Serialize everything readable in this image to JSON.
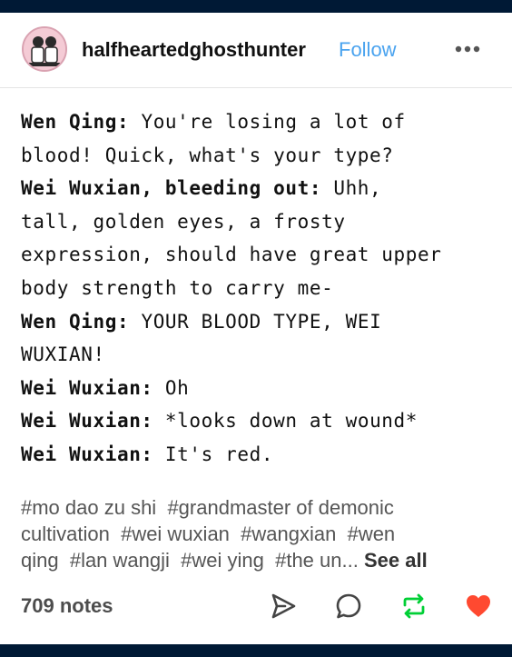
{
  "post": {
    "username": "halfheartedghosthunter",
    "follow_label": "Follow",
    "more_icon": "more-icon",
    "lines": [
      {
        "speaker": "Wen Qing:",
        "text": " You're losing a lot of"
      },
      {
        "speaker": "",
        "text": "blood! Quick, what's your type?"
      },
      {
        "speaker": "Wei Wuxian, bleeding out:",
        "text": " Uhh,"
      },
      {
        "speaker": "",
        "text": "tall, golden eyes, a frosty"
      },
      {
        "speaker": "",
        "text": "expression, should have great upper"
      },
      {
        "speaker": "",
        "text": "body strength to carry me-"
      },
      {
        "speaker": "Wen Qing:",
        "text": " YOUR BLOOD TYPE, WEI"
      },
      {
        "speaker": "",
        "text": "WUXIAN!"
      },
      {
        "speaker": "Wei Wuxian:",
        "text": " Oh"
      },
      {
        "speaker": "Wei Wuxian:",
        "text": " *looks down at wound*"
      },
      {
        "speaker": "Wei Wuxian:",
        "text": " It's red."
      }
    ],
    "tags": [
      "#mo dao zu shi",
      "#grandmaster of demonic",
      "cultivation",
      "#wei wuxian",
      "#wangxian",
      "#wen",
      "qing",
      "#lan wangji",
      "#wei ying",
      "#the un..."
    ],
    "see_all_label": "See all",
    "notes_label": "709 notes",
    "icons": [
      "share-icon",
      "reply-icon",
      "reblog-icon",
      "like-icon"
    ],
    "colors": {
      "follow": "#4aa3ef",
      "reblog": "#00cf35",
      "like": "#ff4930",
      "frame": "#001935"
    }
  }
}
